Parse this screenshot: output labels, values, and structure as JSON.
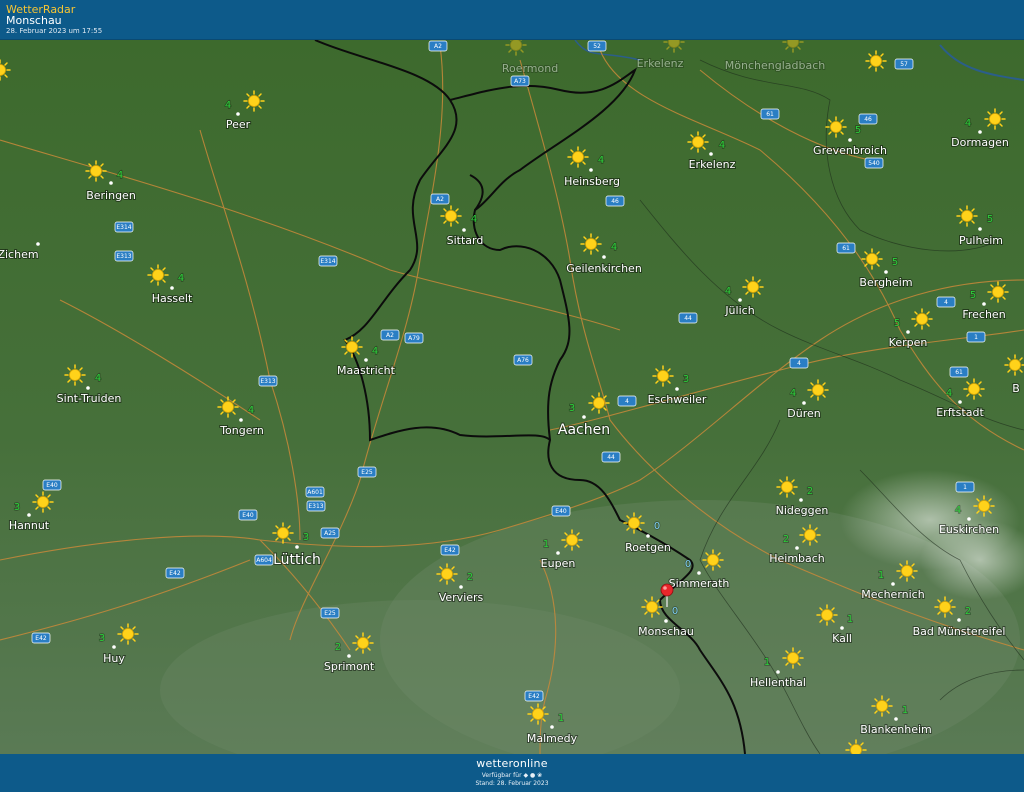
{
  "header": {
    "app_title": "WetterRadar",
    "location": "Monschau",
    "timestamp": "28. Februar 2023 um 17:55"
  },
  "footer": {
    "brand": "wetteronline",
    "available_text": "Verfügbar für",
    "stand_text": "Stand: 28. Februar 2023"
  },
  "colors": {
    "header_bg": "#0d5a8a",
    "map_bg": "#3f6a2e",
    "temp_green": "#2bd13a",
    "temp_zero": "#7ed0f3",
    "sun": "#ffd21a",
    "road_badge": "#2a7ec4",
    "pin": "#e8262b"
  },
  "icons": [
    "sun-icon",
    "location-pin-icon",
    "apple-icon",
    "android-icon",
    "huawei-icon"
  ],
  "places": [
    {
      "name": "Roermond",
      "temp": ""
    },
    {
      "name": "Erkelenz",
      "temp": ""
    },
    {
      "name": "Mönchengladbach",
      "temp": ""
    },
    {
      "name": "Peer",
      "temp": "4"
    },
    {
      "name": "Beringen",
      "temp": "4"
    },
    {
      "name": "Heinsberg",
      "temp": "4"
    },
    {
      "name": "Erkelenz",
      "temp": "4"
    },
    {
      "name": "Grevenbroich",
      "temp": "5"
    },
    {
      "name": "Dormagen",
      "temp": "4"
    },
    {
      "name": "Zichem",
      "temp": ""
    },
    {
      "name": "Sittard",
      "temp": "4"
    },
    {
      "name": "Geilenkirchen",
      "temp": "4"
    },
    {
      "name": "Pulheim",
      "temp": "5"
    },
    {
      "name": "Hasselt",
      "temp": "4"
    },
    {
      "name": "Bergheim",
      "temp": "5"
    },
    {
      "name": "Jülich",
      "temp": "4"
    },
    {
      "name": "Frechen",
      "temp": "5"
    },
    {
      "name": "Kerpen",
      "temp": "5"
    },
    {
      "name": "Maastricht",
      "temp": "4"
    },
    {
      "name": "Sint-Truiden",
      "temp": "4"
    },
    {
      "name": "Eschweiler",
      "temp": "3"
    },
    {
      "name": "Düren",
      "temp": "4"
    },
    {
      "name": "Erftstadt",
      "temp": "4"
    },
    {
      "name": "Tongern",
      "temp": "4"
    },
    {
      "name": "Aachen",
      "temp": "3"
    },
    {
      "name": "Hannut",
      "temp": "3"
    },
    {
      "name": "Nideggen",
      "temp": "2"
    },
    {
      "name": "Euskirchen",
      "temp": "4"
    },
    {
      "name": "Roetgen",
      "temp": "0"
    },
    {
      "name": "Lüttich",
      "temp": "3"
    },
    {
      "name": "Eupen",
      "temp": "1"
    },
    {
      "name": "Heimbach",
      "temp": "2"
    },
    {
      "name": "Simmerath",
      "temp": "0"
    },
    {
      "name": "Verviers",
      "temp": "2"
    },
    {
      "name": "Mechernich",
      "temp": "1"
    },
    {
      "name": "Monschau",
      "temp": "0"
    },
    {
      "name": "Kall",
      "temp": "1"
    },
    {
      "name": "Bad Münstereifel",
      "temp": "2"
    },
    {
      "name": "Huy",
      "temp": "3"
    },
    {
      "name": "Sprimont",
      "temp": "2"
    },
    {
      "name": "Hellenthal",
      "temp": "1"
    },
    {
      "name": "Blankenheim",
      "temp": "1"
    },
    {
      "name": "Malmedy",
      "temp": "1"
    },
    {
      "name": "B",
      "temp": ""
    }
  ],
  "roads": [
    "A2",
    "52",
    "A73",
    "57",
    "61",
    "46",
    "540",
    "A2",
    "46",
    "E314",
    "E313",
    "E314",
    "61",
    "A2",
    "A79",
    "4",
    "44",
    "A76",
    "E313",
    "4",
    "4",
    "61",
    "1",
    "E25",
    "44",
    "E40",
    "A601",
    "E313",
    "E40",
    "E40",
    "A25",
    "E42",
    "1",
    "A604",
    "E42",
    "E25",
    "E42",
    "E42"
  ]
}
